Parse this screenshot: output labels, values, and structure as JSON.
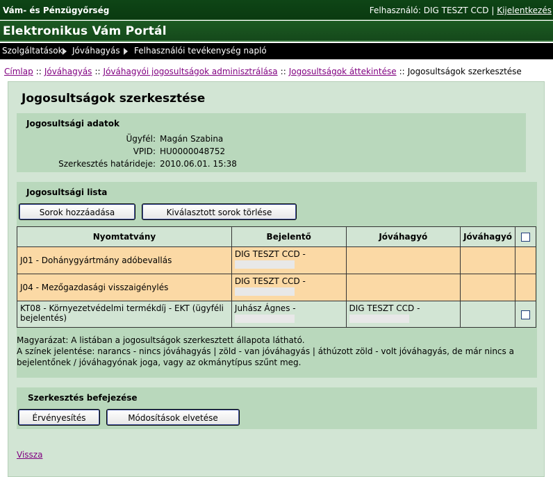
{
  "header": {
    "org": "Vám- és Pénzügyőrség",
    "user_label": "Felhasználó: DIG TESZT CCD",
    "user_sep": "|",
    "logout": "Kijelentkezés",
    "title": "Elektronikus Vám Portál"
  },
  "nav": {
    "items": [
      "Szolgáltatások",
      "Jóváhagyás",
      "Felhasználói tevékenység napló"
    ]
  },
  "breadcrumb": {
    "items": [
      "Címlap",
      "Jóváhagyás",
      "Jóváhagyói jogosultságok adminisztrálása",
      "Jogosultságok áttekintése"
    ],
    "sep": "::",
    "current": "Jogosultságok szerkesztése"
  },
  "page": {
    "title": "Jogosultságok szerkesztése"
  },
  "details": {
    "heading": "Jogosultsági adatok",
    "rows": [
      {
        "label": "Ügyfél:",
        "value": "Magán Szabina"
      },
      {
        "label": "VPID:",
        "value": "HU0000048752"
      },
      {
        "label": "Szerkesztés határideje:",
        "value": "2010.06.01. 15:38"
      }
    ]
  },
  "list": {
    "heading": "Jogosultsági lista",
    "add_button": "Sorok hozzáadása",
    "delete_button": "Kiválasztott sorok törlése",
    "columns": [
      "Nyomtatvány",
      "Bejelentő",
      "Jóváhagyó",
      "Jóváhagyó"
    ],
    "rows": [
      {
        "status": "orange",
        "form": "J01 - Dohánygyártmány adóbevallás",
        "reporter": "DIG TESZT CCD -",
        "approver": "",
        "approver2": "",
        "checkbox": false
      },
      {
        "status": "orange",
        "form": "J04 - Mezőgazdasági visszaigénylés",
        "reporter": "DIG TESZT CCD -",
        "approver": "",
        "approver2": "",
        "checkbox": false
      },
      {
        "status": "green",
        "form": "KT08 - Környezetvédelmi termékdíj - EKT (ügyféli bejelentés)",
        "reporter": "Juhász Ágnes -",
        "approver": "DIG TESZT CCD -",
        "approver2": "",
        "checkbox": true
      }
    ],
    "legend_line1": "Magyarázat: A listában a jogosultságok szerkesztett állapota látható.",
    "legend_line2": "A színek jelentése: narancs - nincs jóváhagyás | zöld - van jóváhagyás | áthúzott zöld - volt jóváhagyás, de már nincs a bejelentőnek / jóváhagyónak joga, vagy az okmánytípus szűnt meg."
  },
  "finish": {
    "heading": "Szerkesztés befejezése",
    "validate_button": "Érvényesítés",
    "discard_button": "Módosítások elvetése"
  },
  "back_link": "Vissza",
  "colors": {
    "header_dark_green": "#0e4516",
    "title_green": "#1c5a22",
    "panel_green": "#d2e5d4",
    "box_green": "#b9d8bc",
    "row_orange": "#fbd9a5",
    "link_purple": "#800080"
  }
}
